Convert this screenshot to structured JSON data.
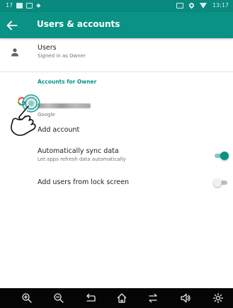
{
  "status_bar": {
    "left_text": "17",
    "time": "13:17"
  },
  "app_bar": {
    "title": "Users & accounts"
  },
  "users": {
    "title": "Users",
    "subtitle": "Signed in as Owner"
  },
  "accounts_section": {
    "header": "Accounts for Owner",
    "account_type": "Google"
  },
  "add_account_label": "Add account",
  "sync": {
    "title": "Automatically sync data",
    "subtitle": "Let apps refresh data automatically",
    "enabled": true
  },
  "lock_screen": {
    "title": "Add users from lock screen",
    "enabled": false
  },
  "nav_icons": [
    "zoom-in-icon",
    "zoom-out-icon",
    "back-icon",
    "home-icon",
    "recents-icon",
    "volume-icon",
    "settings-icon"
  ],
  "colors": {
    "accent": "#0a9385",
    "status_bar": "#0a8a7e",
    "nav_bar": "#050505"
  }
}
